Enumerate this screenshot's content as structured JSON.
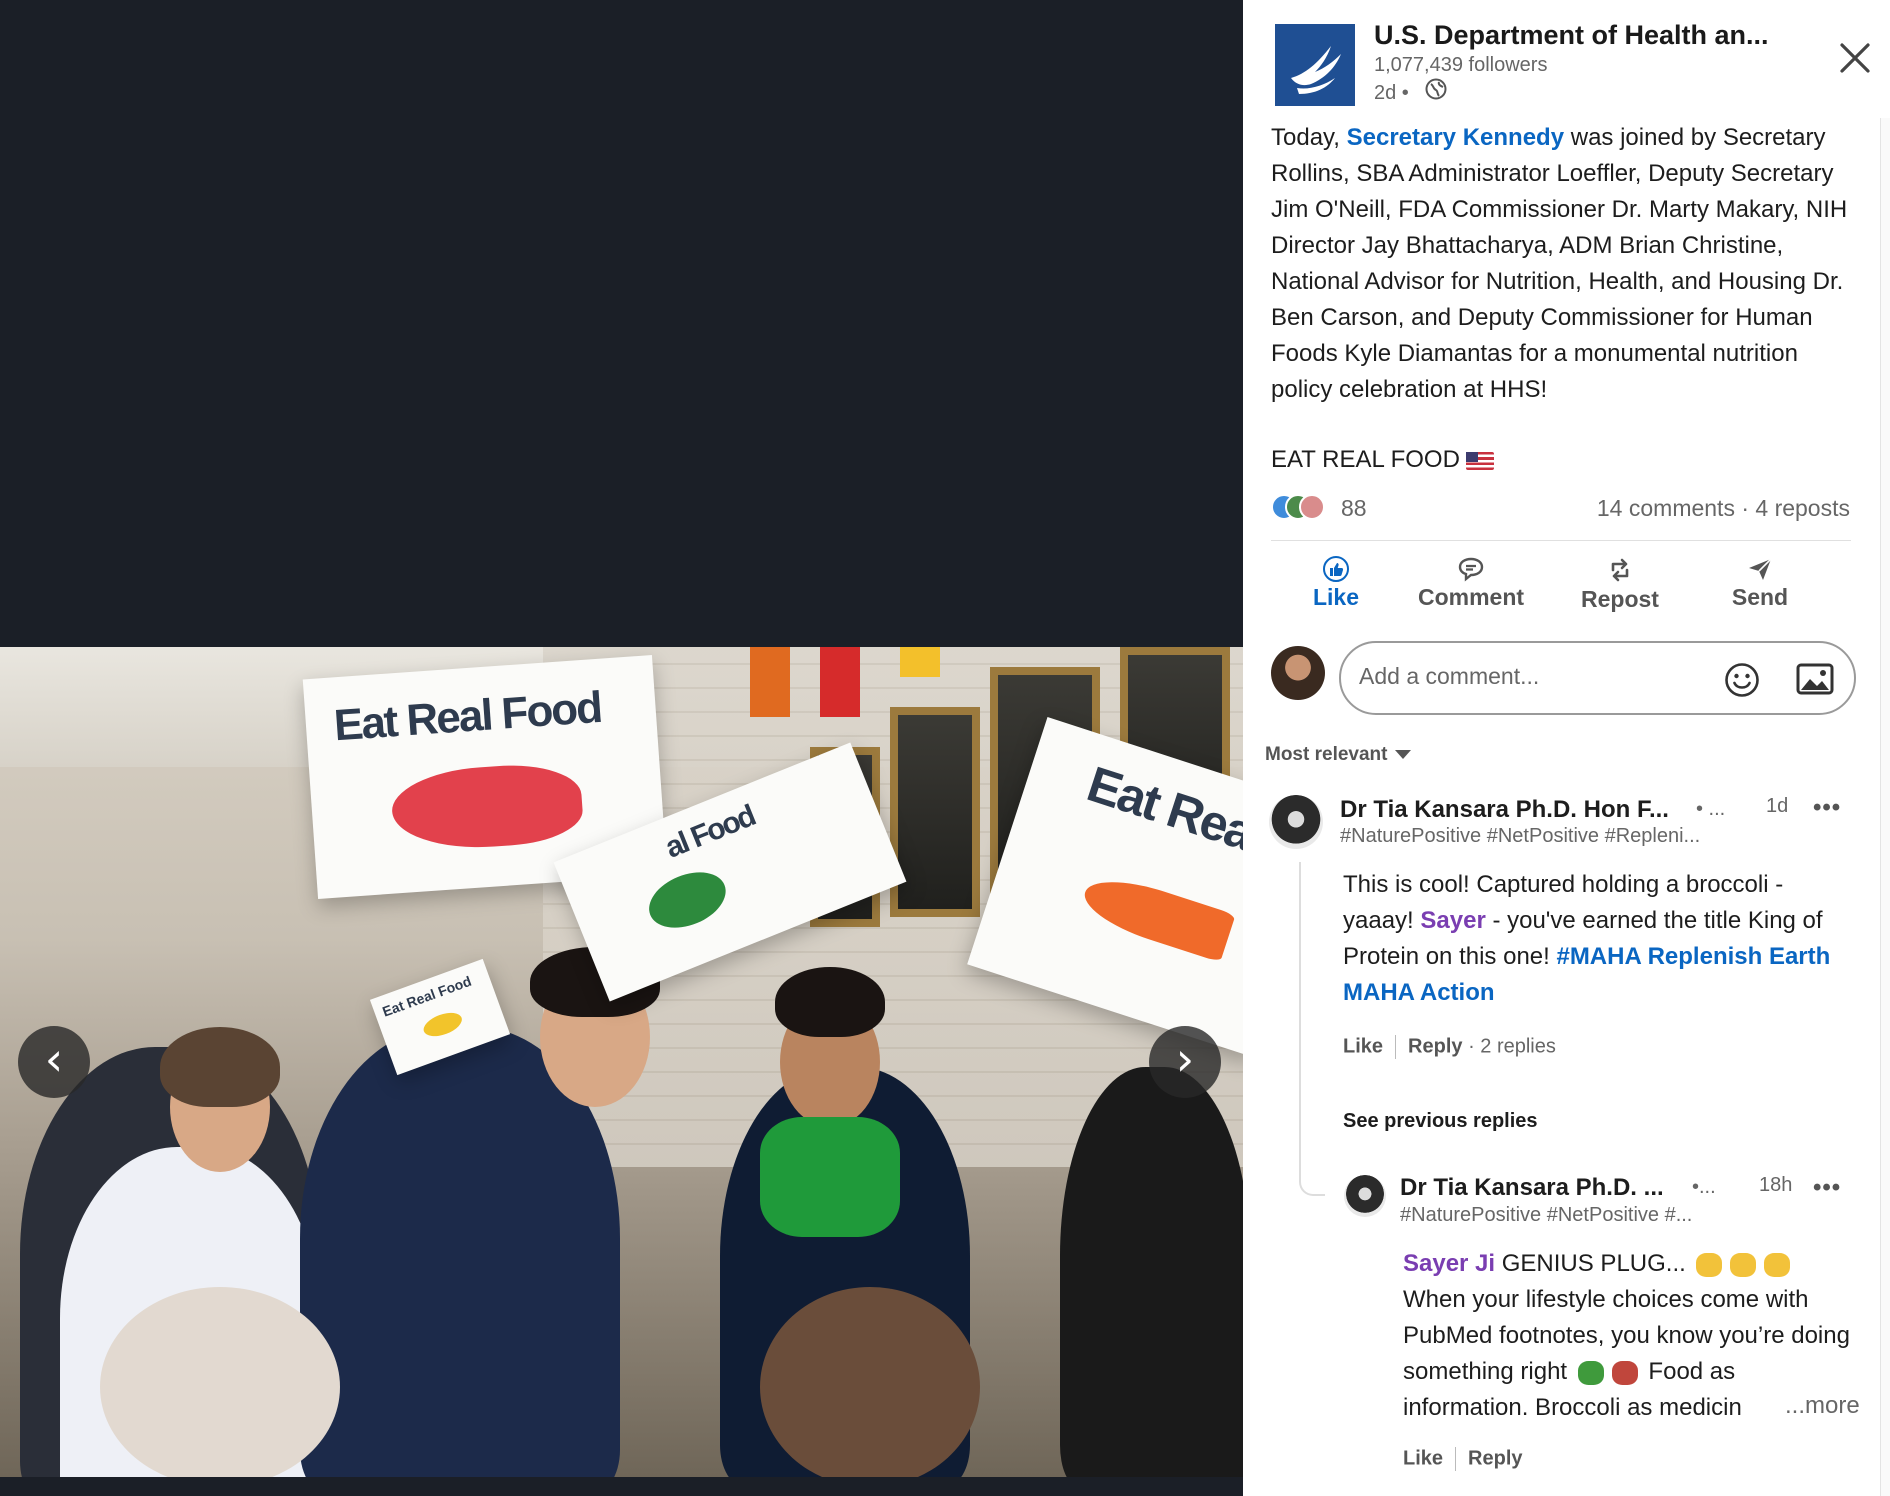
{
  "post": {
    "org_name": "U.S. Department of Health an...",
    "followers": "1,077,439 followers",
    "age": "2d •",
    "body_segments": {
      "a": "Today, ",
      "mention": "Secretary Kennedy",
      "b": " was joined by Secretary Rollins, SBA Administrator Loeffler, Deputy Secretary Jim O'Neill, FDA Commissioner Dr. Marty Makary, NIH Director Jay Bhattacharya, ADM Brian Christine, National Advisor for Nutrition, Health, and Housing Dr. Ben Carson, and Deputy Commissioner for Human Foods Kyle Diamantas for a monumental nutrition policy celebration at HHS!"
    },
    "tagline": "EAT REAL FOOD",
    "reaction_count": "88",
    "engagement": "14 comments · 4 reposts"
  },
  "photo": {
    "sign_text_main": "Eat Real Food",
    "sign_text_second": "al Food",
    "sign_text_right": "Eat Real F",
    "sign_text_small": "Eat Real Food"
  },
  "actions": {
    "like": "Like",
    "comment": "Comment",
    "repost": "Repost",
    "send": "Send"
  },
  "composer": {
    "placeholder": "Add a comment..."
  },
  "sort": {
    "label": "Most relevant"
  },
  "comments": [
    {
      "name": "Dr Tia Kansara Ph.D. Hon F...",
      "degree": "• ...",
      "headline": "#NaturePositive #NetPositive #Repleni...",
      "time": "1d",
      "more": "•••",
      "body": {
        "a": "This is cool! Captured holding a broccoli - yaaay! ",
        "mention": "Sayer",
        "b": " - you've earned the title King of Protein on this one! ",
        "hashtag": "#MAHA Replenish Earth MAHA Action"
      },
      "like": "Like",
      "reply": "Reply",
      "replies": "· 2 replies"
    }
  ],
  "see_previous": "See previous replies",
  "reply": {
    "name": "Dr Tia Kansara Ph.D. ...",
    "degree": "•...",
    "headline": "#NaturePositive #NetPositive #...",
    "time": "18h",
    "more": "•••",
    "mention": "Sayer Ji",
    "text_a": " GENIUS PLUG...",
    "text_b": "When your lifestyle choices come with PubMed footnotes, you know you’re doing something right",
    "text_c": " Food as information. Broccoli as medicin",
    "see_more": "...more",
    "like": "Like",
    "reply": "Reply"
  },
  "colors": {
    "brand_blue": "#0a66c2",
    "mention_purple": "#7a3eb1",
    "media_bg": "#1b1f27",
    "hhs_blue": "#1f4f93"
  },
  "icons": [
    "globe-icon",
    "close-icon",
    "like-icon",
    "comment-icon",
    "repost-icon",
    "send-icon",
    "emoji-icon",
    "image-icon",
    "chevron-left-icon",
    "chevron-right-icon",
    "caret-down-icon",
    "clap-emoji",
    "broccoli-emoji",
    "books-emoji"
  ]
}
